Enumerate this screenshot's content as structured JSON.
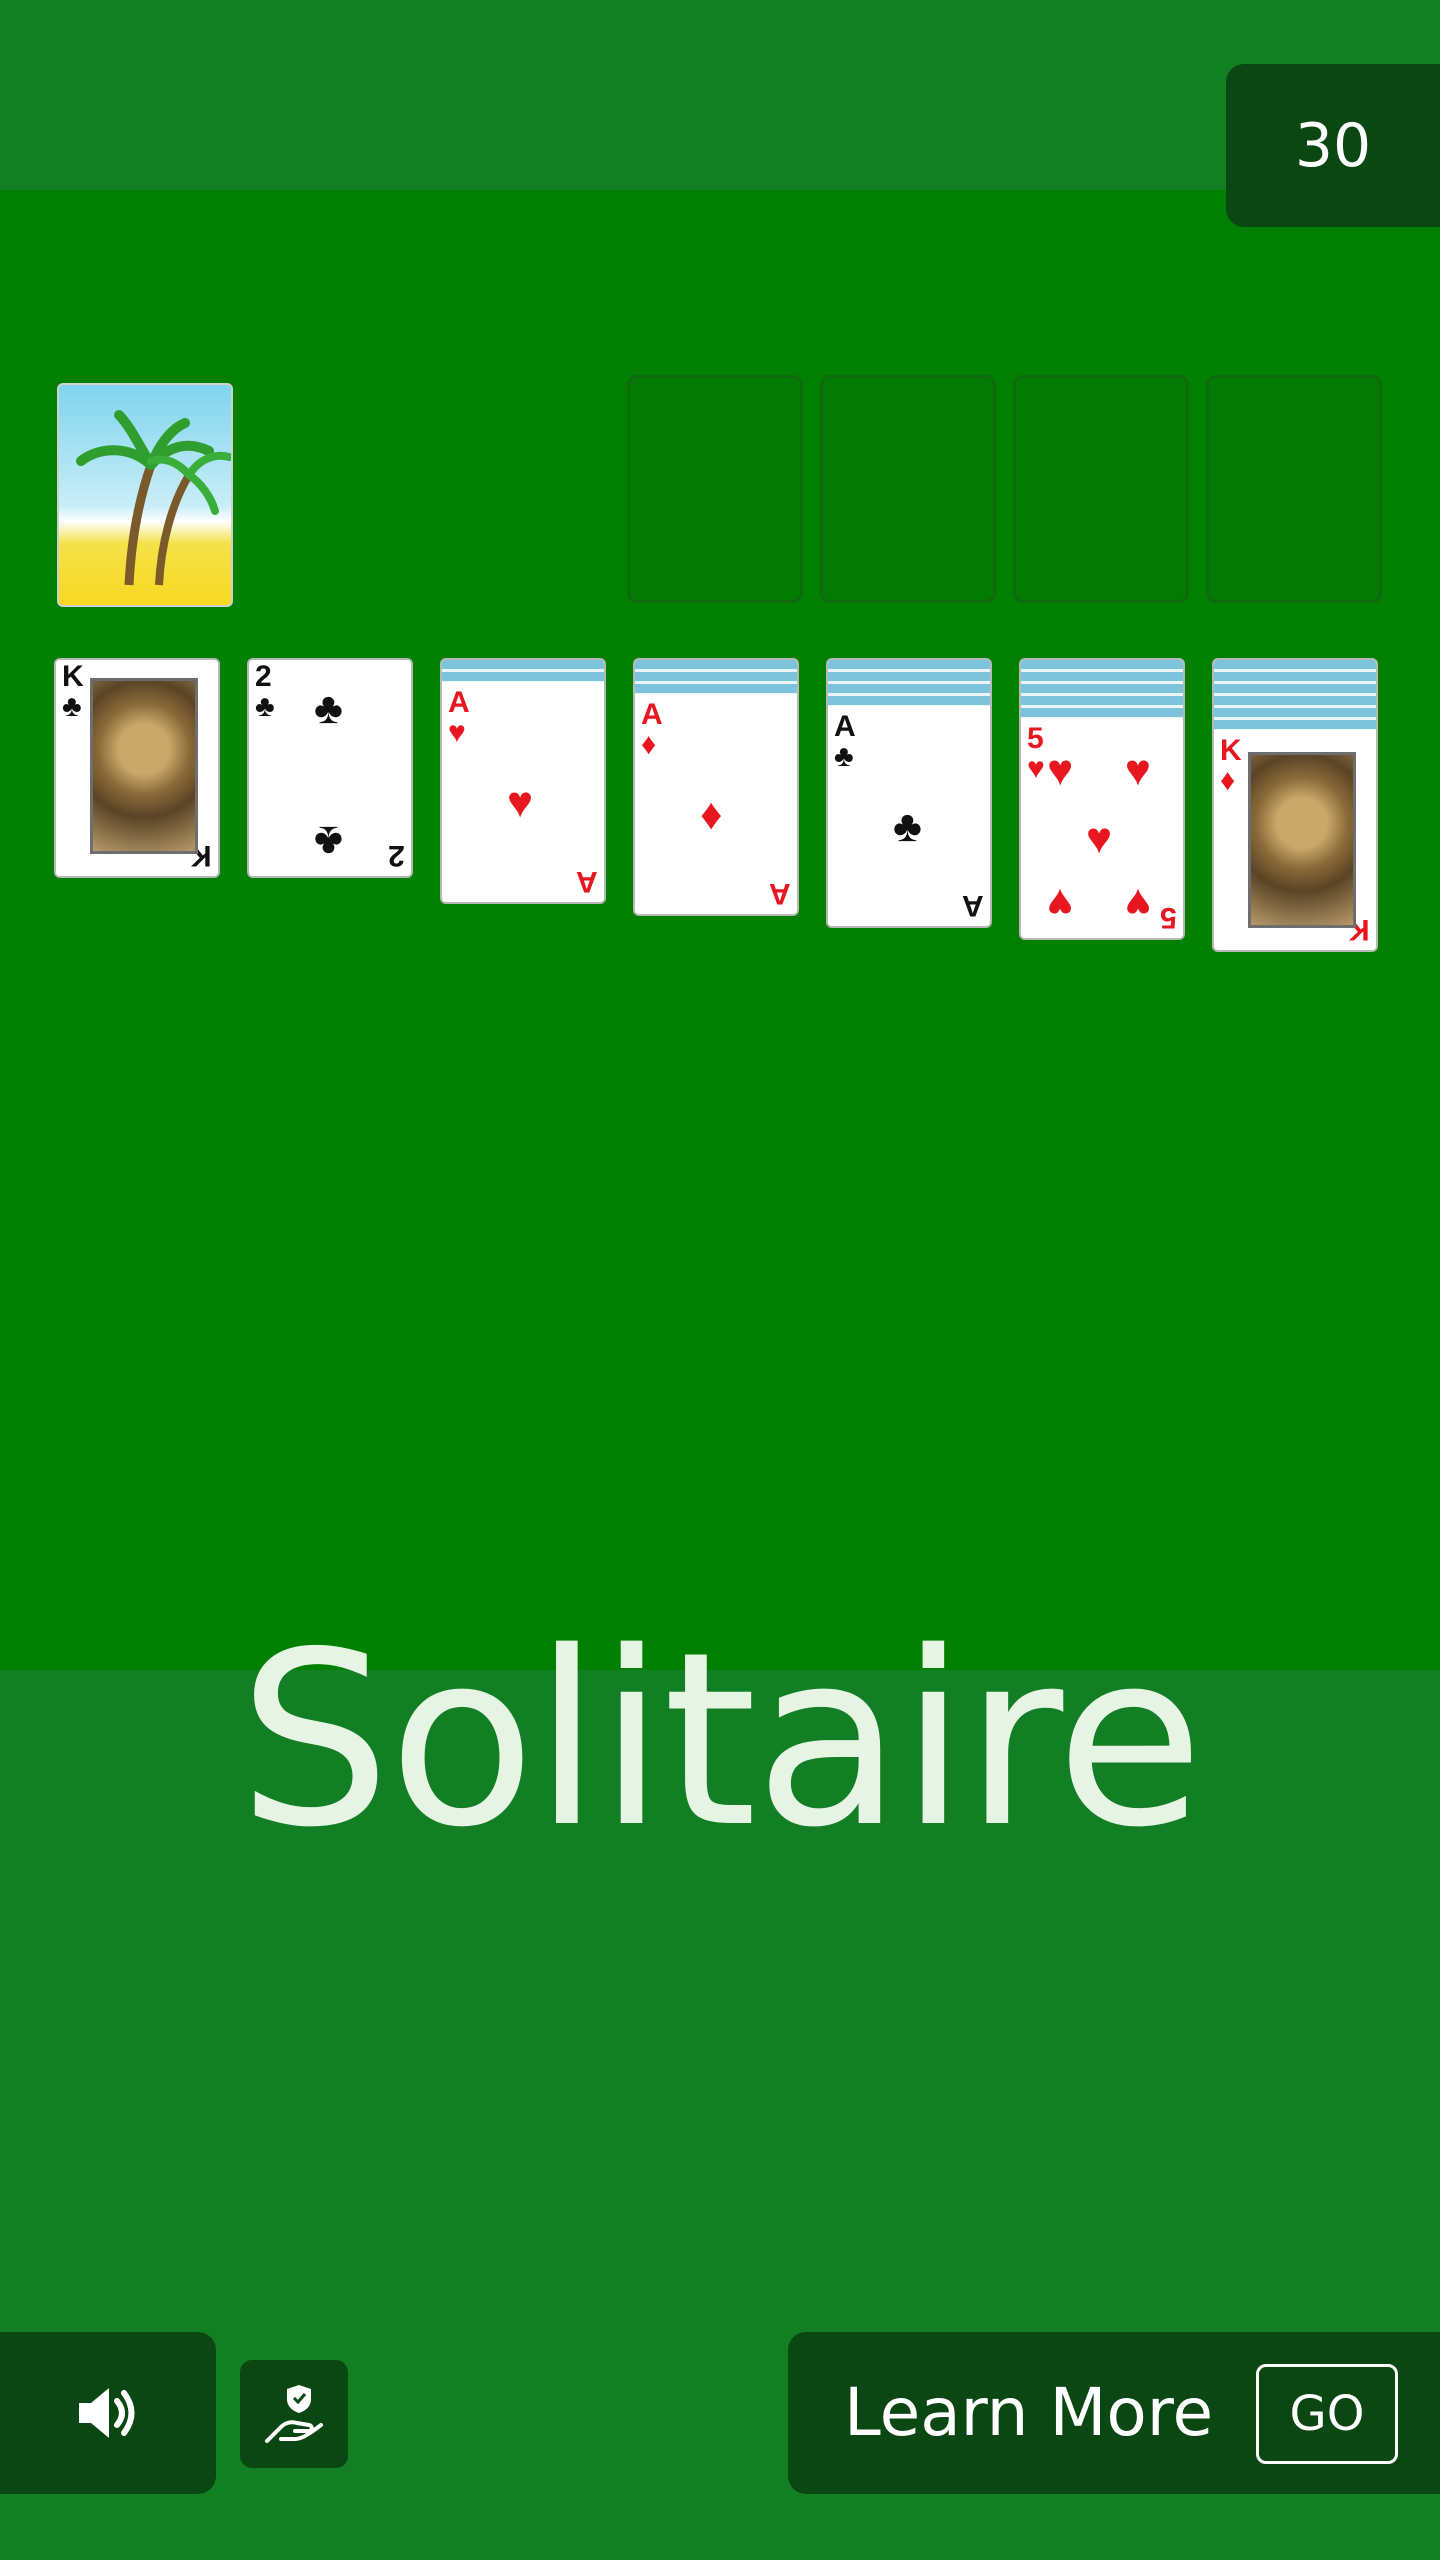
{
  "timer": {
    "seconds": "30"
  },
  "title": "Solitaire",
  "stock": {
    "icon": "palm-tree-beach-card-back"
  },
  "foundations": [
    "",
    "",
    "",
    ""
  ],
  "tableau": [
    {
      "rank": "K",
      "suit": "♣",
      "color": "black",
      "hidden": 0
    },
    {
      "rank": "2",
      "suit": "♣",
      "color": "black",
      "hidden": 0
    },
    {
      "rank": "A",
      "suit": "♥",
      "color": "red",
      "hidden": 1
    },
    {
      "rank": "A",
      "suit": "♦",
      "color": "red",
      "hidden": 2
    },
    {
      "rank": "A",
      "suit": "♣",
      "color": "black",
      "hidden": 3
    },
    {
      "rank": "5",
      "suit": "♥",
      "color": "red",
      "hidden": 4
    },
    {
      "rank": "K",
      "suit": "♦",
      "color": "red",
      "hidden": 5
    }
  ],
  "footer": {
    "sound_icon": "speaker-icon",
    "privacy_icon": "hand-shield-icon",
    "learn_more": "Learn More",
    "go": "GO"
  },
  "colors": {
    "felt": "#018001",
    "band": "#137f24",
    "panel": "#0a4712",
    "red_suit": "#e8161e"
  }
}
